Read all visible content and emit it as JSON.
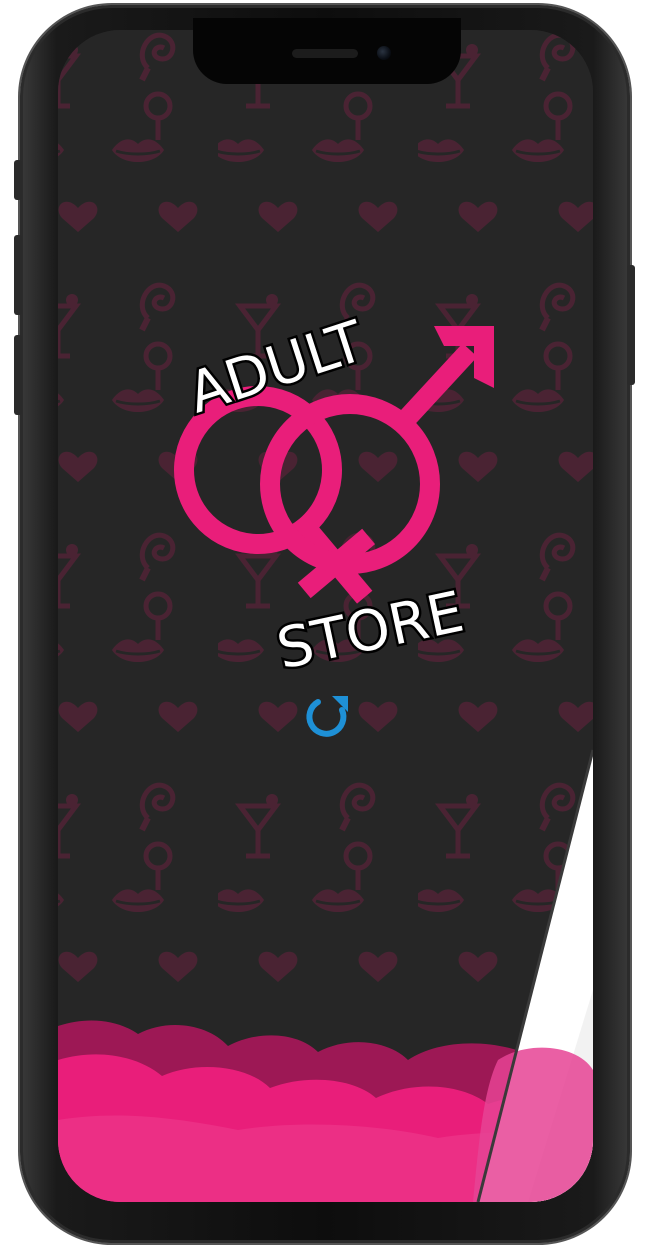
{
  "app": {
    "logo_top_text": "ADULT",
    "logo_bottom_text": "STORE"
  },
  "loading": {
    "icon": "refresh-icon"
  },
  "colors": {
    "brand_pink": "#E91E7A",
    "background": "#262626",
    "pattern": "#4a2333",
    "spinner_blue": "#1E90D6"
  }
}
